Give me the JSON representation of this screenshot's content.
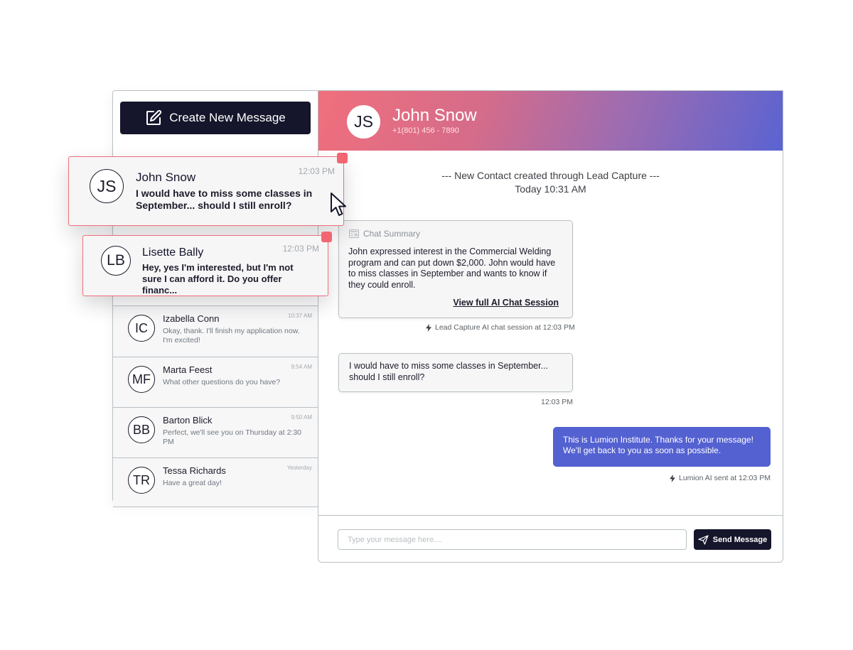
{
  "sidebar": {
    "create_label": "Create New Message",
    "highlighted": [
      {
        "initials": "JS",
        "name": "John Snow",
        "time": "12:03 PM",
        "message": "I would have to miss some classes in September... should I still enroll?"
      },
      {
        "initials": "LB",
        "name": "Lisette Bally",
        "time": "12:03 PM",
        "message": "Hey, yes I'm interested, but I'm not sure I can afford it. Do you offer financ..."
      }
    ],
    "conversations": [
      {
        "initials": "IC",
        "name": "Izabella Conn",
        "time": "10:37 AM",
        "preview": "Okay, thank. I'll finish my application now. I'm excited!"
      },
      {
        "initials": "MF",
        "name": "Marta Feest",
        "time": "9:54 AM",
        "preview": "What other questions do you have?"
      },
      {
        "initials": "BB",
        "name": "Barton Blick",
        "time": "9:50 AM",
        "preview": "Perfect, we'll see you on Thursday at 2:30 PM"
      },
      {
        "initials": "TR",
        "name": "Tessa Richards",
        "time": "Yesterday",
        "preview": "Have a great day!"
      }
    ]
  },
  "chat": {
    "contact": {
      "initials": "JS",
      "name": "John Snow",
      "phone": "+1(801) 456 - 7890"
    },
    "system_note": {
      "line1": "--- New Contact created through Lead Capture ---",
      "line2": "Today 10:31 AM"
    },
    "summary": {
      "title": "Chat Summary",
      "text": "John expressed interest in the Commercial Welding program and can put down $2,000. John would have to miss classes in September and wants to know if they could enroll.",
      "link": "View full AI Chat Session",
      "meta": "Lead Capture AI chat session at 12:03 PM"
    },
    "incoming": {
      "text": "I would have to miss some classes in September... should I still enroll?",
      "time": "12:03 PM"
    },
    "outgoing": {
      "text": "This is Lumion Institute. Thanks for your message! We'll get back to you as soon as possible.",
      "meta": "Lumion AI sent at 12:03 PM"
    },
    "composer": {
      "placeholder": "Type your message here....",
      "send_label": "Send Message"
    }
  },
  "colors": {
    "primary_dark": "#15152b",
    "accent_blue": "#5461d1",
    "highlight_red": "#f16671",
    "gradient_start": "#f06f7c",
    "gradient_end": "#5a63d2"
  },
  "icons": {
    "create": "edit-square-icon",
    "summary": "summary-doc-icon",
    "meta": "lightning-bolt-icon",
    "send": "paper-plane-icon",
    "cursor": "mouse-pointer-icon"
  }
}
